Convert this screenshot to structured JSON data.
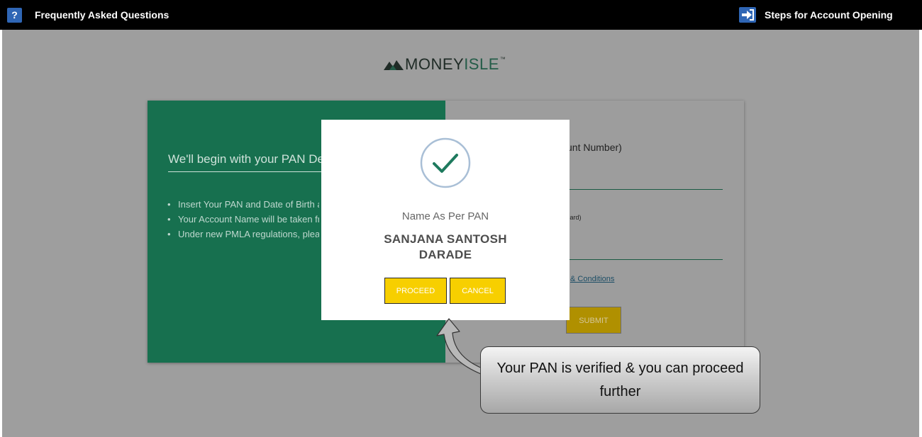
{
  "topbar": {
    "faq_icon_glyph": "?",
    "faq_icon": "question-icon",
    "faq_label": "Frequently Asked Questions",
    "steps_icon": "sign-in-arrow-icon",
    "steps_label": "Steps for Account Opening"
  },
  "logo": {
    "money": "MONEY",
    "isle": "ISLE",
    "tm": "™"
  },
  "form": {
    "heading": "We'll begin with your PAN Details",
    "bullets": [
      "Insert Your PAN and Date of Birth as per your PAN Card",
      "Your Account Name will be taken from the Income Tax Database",
      "Under new PMLA regulations, please ensure your Aadhar Number is Seeded in your PAN"
    ],
    "pan_label": "unt Number)",
    "dob_label": "card)",
    "terms_link": "& Conditions",
    "submit_label": "SUBMIT"
  },
  "modal": {
    "icon": "checkmark-circle-icon",
    "name_label": "Name As Per PAN",
    "name_value": "SANJANA SANTOSH DARADE",
    "proceed_label": "PROCEED",
    "cancel_label": "CANCEL"
  },
  "callout": {
    "text": "Your PAN is verified & you can proceed further"
  },
  "colors": {
    "topbar": "#000000",
    "icon_blue": "#2f66b5",
    "overlay": "#9e9e9e",
    "panel_green": "#17704f",
    "button_yellow": "#f7cf00",
    "check_teal": "#1e7a5e",
    "check_ring": "#a9bfd6"
  }
}
